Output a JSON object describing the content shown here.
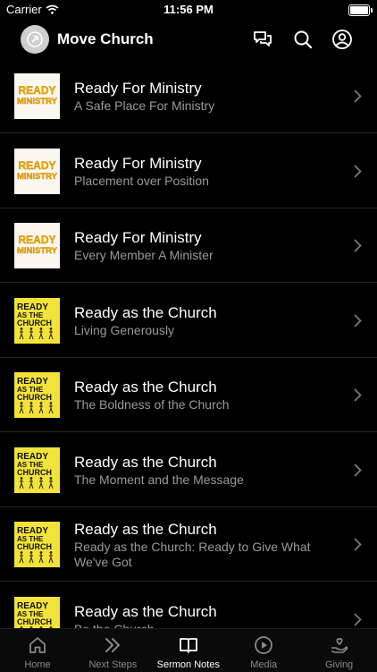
{
  "status_bar": {
    "carrier": "Carrier",
    "time": "11:56 PM"
  },
  "header": {
    "title": "Move Church",
    "icons": [
      "chat-icon",
      "search-icon",
      "profile-icon"
    ]
  },
  "series_art": {
    "ministry": {
      "word1": "READY",
      "word2": "MINISTRY"
    },
    "church": {
      "word1": "READY",
      "word2": "AS THE",
      "word3": "CHURCH"
    }
  },
  "sermons": [
    {
      "title": "Ready For Ministry",
      "subtitle": "A Safe Place For Ministry",
      "art": "ministry"
    },
    {
      "title": "Ready For Ministry",
      "subtitle": "Placement over Position",
      "art": "ministry"
    },
    {
      "title": "Ready For Ministry",
      "subtitle": "Every Member A Minister",
      "art": "ministry"
    },
    {
      "title": "Ready as the Church",
      "subtitle": "Living Generously",
      "art": "church"
    },
    {
      "title": "Ready as the Church",
      "subtitle": "The Boldness of the Church",
      "art": "church"
    },
    {
      "title": "Ready as the Church",
      "subtitle": "The Moment and the Message",
      "art": "church"
    },
    {
      "title": "Ready as the Church",
      "subtitle": "Ready as the Church: Ready to Give What We've Got",
      "art": "church"
    },
    {
      "title": "Ready as the Church",
      "subtitle": "Be the Church",
      "art": "church"
    }
  ],
  "tabs": [
    {
      "label": "Home",
      "icon": "home-icon",
      "active": false
    },
    {
      "label": "Next Steps",
      "icon": "chevrons-icon",
      "active": false
    },
    {
      "label": "Sermon Notes",
      "icon": "book-icon",
      "active": true
    },
    {
      "label": "Media",
      "icon": "play-icon",
      "active": false
    },
    {
      "label": "Giving",
      "icon": "hand-heart-icon",
      "active": false
    }
  ],
  "colors": {
    "background": "#000000",
    "subtitle": "#9a9a9a",
    "tab_inactive": "#8a8a8a",
    "church_art": "#f2e23a",
    "ministry_art": "#f5b400"
  }
}
